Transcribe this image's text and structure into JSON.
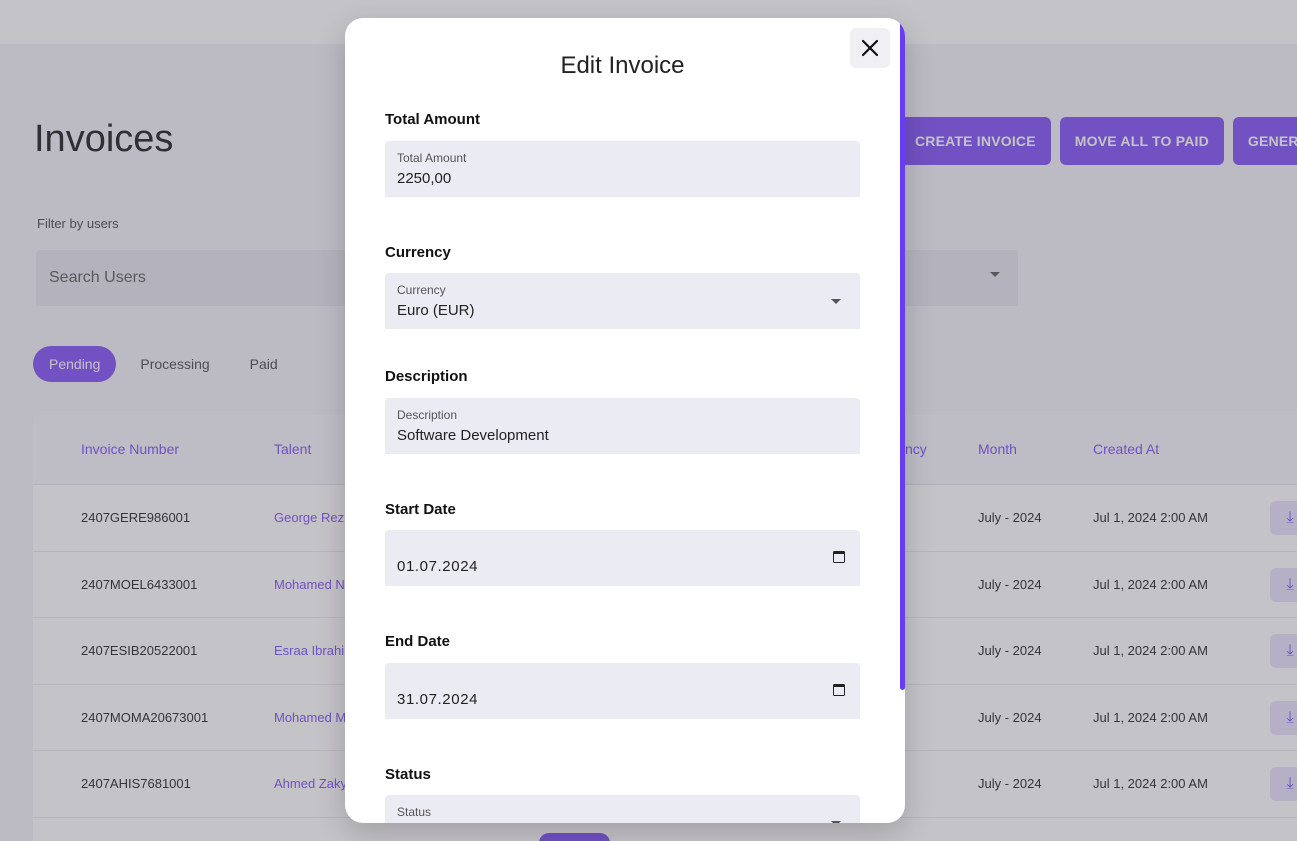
{
  "page": {
    "title": "Invoices",
    "actions": [
      "CREATE INVOICE",
      "MOVE ALL TO PAID",
      "GENERATE"
    ],
    "filter_label": "Filter by users",
    "search_placeholder": "Search Users",
    "tabs": [
      "Pending",
      "Processing",
      "Paid"
    ],
    "table": {
      "headers": {
        "invoice_number": "Invoice Number",
        "talent": "Talent",
        "currency": "ncy",
        "month": "Month",
        "created_at": "Created At"
      },
      "rows": [
        {
          "invoice_number": "2407GERE986001",
          "talent": "George Rezk",
          "month": "July - 2024",
          "created_at": "Jul 1, 2024 2:00 AM"
        },
        {
          "invoice_number": "2407MOEL6433001",
          "talent": "Mohamed N",
          "month": "July - 2024",
          "created_at": "Jul 1, 2024 2:00 AM"
        },
        {
          "invoice_number": "2407ESIB20522001",
          "talent": "Esraa Ibrahi",
          "month": "July - 2024",
          "created_at": "Jul 1, 2024 2:00 AM"
        },
        {
          "invoice_number": "2407MOMA20673001",
          "talent": "Mohamed M",
          "month": "July - 2024",
          "created_at": "Jul 1, 2024 2:00 AM"
        },
        {
          "invoice_number": "2407AHIS7681001",
          "talent": "Ahmed Zaky",
          "month": "July - 2024",
          "created_at": "Jul 1, 2024 2:00 AM"
        }
      ],
      "download_icon": "download-icon"
    }
  },
  "modal": {
    "title": "Edit Invoice",
    "close_icon": "close-icon",
    "sections": {
      "total_amount": {
        "heading": "Total Amount",
        "label": "Total Amount",
        "value": "2250,00"
      },
      "currency": {
        "heading": "Currency",
        "label": "Currency",
        "value": "Euro (EUR)"
      },
      "description": {
        "heading": "Description",
        "label": "Description",
        "value": "Software Development"
      },
      "start_date": {
        "heading": "Start Date",
        "value": "01.07.2024"
      },
      "end_date": {
        "heading": "End Date",
        "value": "31.07.2024"
      },
      "status": {
        "heading": "Status",
        "label": "Status"
      }
    }
  },
  "colors": {
    "accent": "#8a5cf6",
    "scrollbar": "#6a3cf0",
    "field_bg": "#ebebf4"
  }
}
